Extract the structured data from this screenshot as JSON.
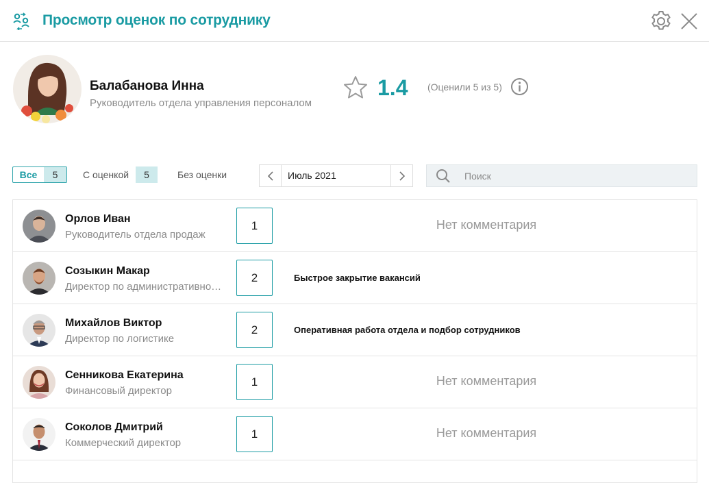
{
  "window": {
    "title": "Просмотр оценок по сотруднику",
    "icons": {
      "app": "people-exchange-icon",
      "settings": "gear-icon",
      "close": "close-icon"
    }
  },
  "colors": {
    "accent": "#1a9ba3",
    "badge_bg": "#cdeaec",
    "muted": "#8a8a8a"
  },
  "employee": {
    "name": "Балабанова Инна",
    "role": "Руководитель отдела управления персоналом",
    "rating": "1.4",
    "rated_count": "(Оценили 5 из 5)"
  },
  "filters": {
    "all_label": "Все",
    "all_count": "5",
    "rated_label": "С оценкой",
    "rated_count": "5",
    "unrated_label": "Без оценки"
  },
  "month": {
    "value": "Июль 2021"
  },
  "search": {
    "placeholder": "Поиск",
    "value": ""
  },
  "reviews": [
    {
      "name": "Орлов Иван",
      "role": "Руководитель отдела продаж",
      "score": "1",
      "comment": "Нет комментария",
      "has_comment": false
    },
    {
      "name": "Созыкин Макар",
      "role": "Директор по административной работе",
      "score": "2",
      "comment": "Быстрое закрытие вакансий",
      "has_comment": true
    },
    {
      "name": "Михайлов Виктор",
      "role": "Директор по логистике",
      "score": "2",
      "comment": "Оперативная работа отдела и подбор сотрудников",
      "has_comment": true
    },
    {
      "name": "Сенникова Екатерина",
      "role": "Финансовый директор",
      "score": "1",
      "comment": "Нет комментария",
      "has_comment": false
    },
    {
      "name": "Соколов Дмитрий",
      "role": "Коммерческий директор",
      "score": "1",
      "comment": "Нет комментария",
      "has_comment": false
    }
  ]
}
